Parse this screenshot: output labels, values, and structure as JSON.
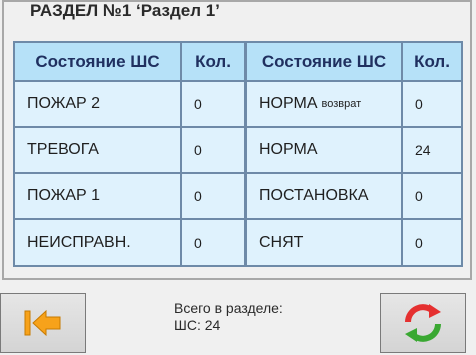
{
  "section": {
    "title": "РАЗДЕЛ №1 ‘Раздел 1’"
  },
  "table": {
    "headers": [
      "Состояние ШС",
      "Кол.",
      "Состояние ШС",
      "Кол."
    ],
    "left_rows": [
      {
        "state": "ПОЖАР 2",
        "count": "0"
      },
      {
        "state": "ТРЕВОГА",
        "count": "0"
      },
      {
        "state": "ПОЖАР 1",
        "count": "0"
      },
      {
        "state": "НЕИСПРАВН.",
        "count": "0"
      }
    ],
    "right_rows": [
      {
        "state": "НОРМА",
        "state_suffix": "возврат",
        "count": "0"
      },
      {
        "state": "НОРМА",
        "count": "24"
      },
      {
        "state": "ПОСТАНОВКА",
        "count": "0"
      },
      {
        "state": "СНЯТ",
        "count": "0"
      }
    ]
  },
  "footer": {
    "total_label": "Всего в разделе:",
    "total_value": "ШС: 24",
    "back_icon": "arrow-left-bar-icon",
    "refresh_icon": "refresh-cycle-icon"
  },
  "colors": {
    "header_bg": "#b6e1f8",
    "cell_bg": "#dff2fd",
    "grid_line": "#6e8aa8"
  }
}
